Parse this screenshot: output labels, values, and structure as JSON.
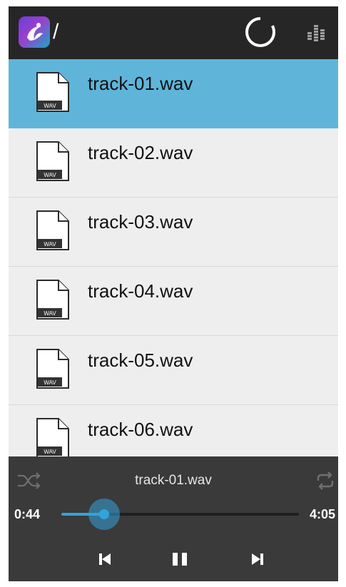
{
  "header": {
    "path": "/",
    "logo_icon": "app-logo-icon",
    "spinner_icon": "loading-spinner-icon",
    "eq_icon": "equalizer-icon"
  },
  "files": [
    {
      "name": "track-01.wav",
      "badge": "WAV",
      "selected": true
    },
    {
      "name": "track-02.wav",
      "badge": "WAV",
      "selected": false
    },
    {
      "name": "track-03.wav",
      "badge": "WAV",
      "selected": false
    },
    {
      "name": "track-04.wav",
      "badge": "WAV",
      "selected": false
    },
    {
      "name": "track-05.wav",
      "badge": "WAV",
      "selected": false
    },
    {
      "name": "track-06.wav",
      "badge": "WAV",
      "selected": false
    }
  ],
  "player": {
    "now_playing": "track-01.wav",
    "elapsed": "0:44",
    "total": "4:05",
    "progress_fraction": 0.18,
    "shuffle_icon": "shuffle-icon",
    "repeat_icon": "repeat-icon",
    "prev_icon": "skip-previous-icon",
    "pause_icon": "pause-icon",
    "next_icon": "skip-next-icon"
  },
  "colors": {
    "topbar": "#262626",
    "selected_row": "#5fb5d9",
    "list_bg": "#eeeeee",
    "player_bg": "#3a3a3a",
    "accent": "#33a3db"
  }
}
